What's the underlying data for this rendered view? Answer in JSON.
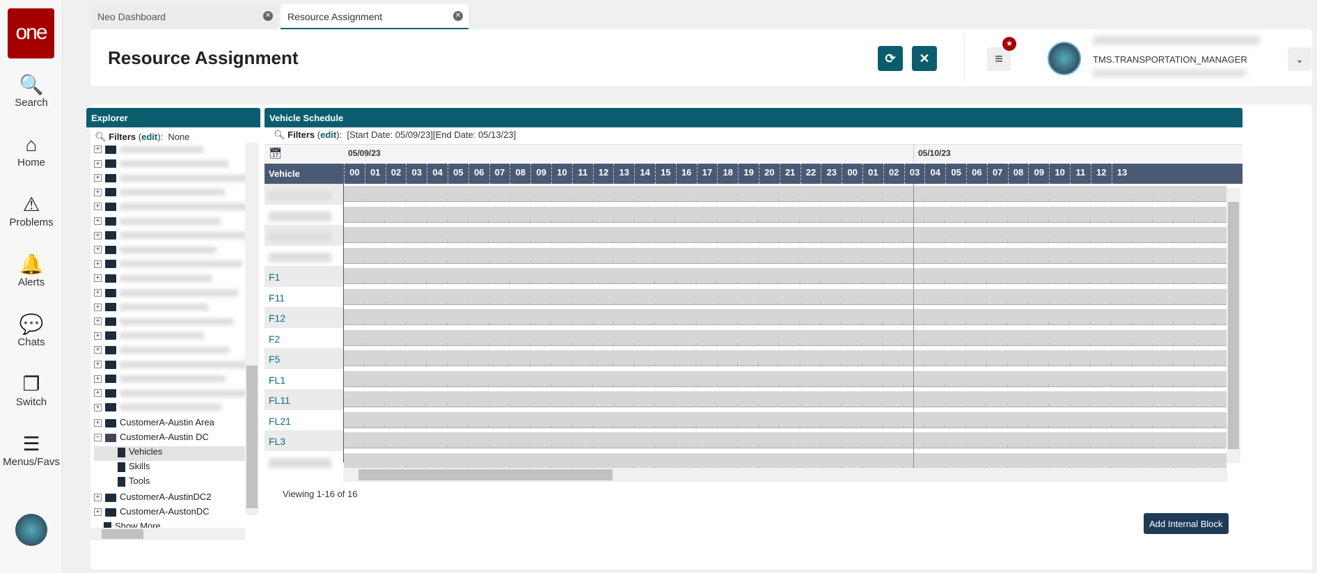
{
  "nav": {
    "logo": "one",
    "items": [
      {
        "label": "Search",
        "icon": "search-icon",
        "glyph": "🔍"
      },
      {
        "label": "Home",
        "icon": "home-icon",
        "glyph": "⌂"
      },
      {
        "label": "Problems",
        "icon": "warning-icon",
        "glyph": "⚠"
      },
      {
        "label": "Alerts",
        "icon": "bell-icon",
        "glyph": "🔔"
      },
      {
        "label": "Chats",
        "icon": "chat-icon",
        "glyph": "💬"
      },
      {
        "label": "Switch",
        "icon": "switch-icon",
        "glyph": "❐"
      },
      {
        "label": "Menus/Favs",
        "icon": "menu-icon",
        "glyph": "☰"
      }
    ]
  },
  "tabs": [
    {
      "label": "Neo Dashboard"
    },
    {
      "label": "Resource Assignment"
    }
  ],
  "header": {
    "title": "Resource Assignment",
    "user": "TMS.TRANSPORTATION_MANAGER"
  },
  "explorer": {
    "title": "Explorer",
    "filters_label": "Filters",
    "edit": "edit",
    "filters_value": "None",
    "items": [
      {
        "label": "CustomerA-Austin Area",
        "type": "folder"
      },
      {
        "label": "CustomerA-Austin DC",
        "type": "folder-open"
      },
      {
        "label": "Vehicles",
        "type": "doc",
        "selected": true
      },
      {
        "label": "Skills",
        "type": "doc"
      },
      {
        "label": "Tools",
        "type": "doc"
      },
      {
        "label": "CustomerA-AustinDC2",
        "type": "folder"
      },
      {
        "label": "CustomerA-AustonDC",
        "type": "folder"
      },
      {
        "label": "Show More...",
        "type": "doc"
      }
    ]
  },
  "schedule": {
    "title": "Vehicle Schedule",
    "filters_label": "Filters",
    "edit": "edit",
    "filters_value": "[Start Date: 05/09/23][End Date: 05/13/23]",
    "dates": [
      "05/09/23",
      "05/10/23"
    ],
    "vehicle_header": "Vehicle",
    "hours": [
      "00",
      "01",
      "02",
      "03",
      "04",
      "05",
      "06",
      "07",
      "08",
      "09",
      "10",
      "11",
      "12",
      "13",
      "14",
      "15",
      "16",
      "17",
      "18",
      "19",
      "20",
      "21",
      "22",
      "23",
      "00",
      "01",
      "02",
      "03",
      "04",
      "05",
      "06",
      "07",
      "08",
      "09",
      "10",
      "11",
      "12",
      "13"
    ],
    "vehicles": [
      "",
      "",
      "",
      "",
      "F1",
      "F11",
      "F12",
      "F2",
      "F5",
      "FL1",
      "FL11",
      "FL21",
      "FL3",
      ""
    ],
    "viewing": "Viewing 1-16 of 16",
    "add_button": "Add Internal Block"
  },
  "colors": {
    "accent": "#0b5d6e",
    "brand": "#a50000",
    "grid_header": "#4a5a75"
  }
}
